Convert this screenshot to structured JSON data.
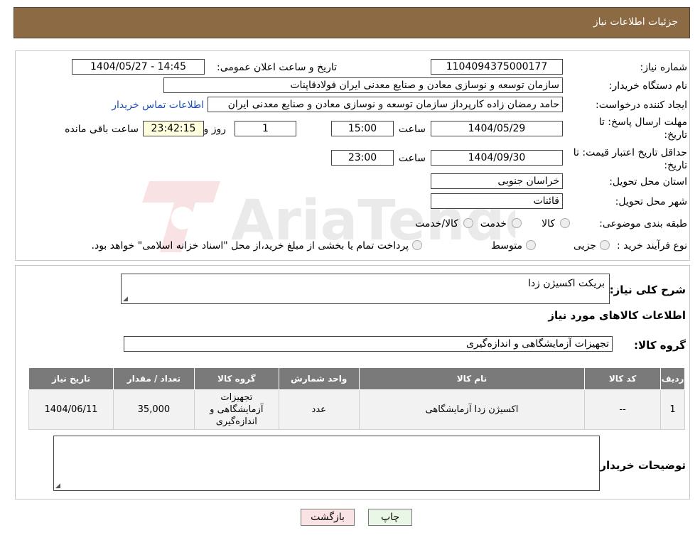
{
  "header": {
    "title": "جزئیات اطلاعات نیاز"
  },
  "form": {
    "need_number_label": "شماره نیاز:",
    "need_number": "1104094375000177",
    "announce_label": "تاریخ و ساعت اعلان عمومی:",
    "announce_value": "1404/05/27 - 14:45",
    "buyer_org_label": "نام دستگاه خریدار:",
    "buyer_org": "سازمان توسعه و نوسازی معادن و صنایع معدنی ایران فولادقاپنات",
    "requester_label": "ایجاد کننده درخواست:",
    "requester": "حامد  رمضان زاده  کارپرداز  سازمان توسعه و نوسازی معادن و صنایع معدنی ایران",
    "contact_link": "اطلاعات تماس خریدار",
    "deadline_label_1": "مهلت ارسال پاسخ: تا",
    "deadline_label_2": "تاریخ:",
    "deadline_date": "1404/05/29",
    "time_label": "ساعت",
    "deadline_time": "15:00",
    "days_value": "1",
    "days_label": "روز و",
    "remaining_value": "23:42:15",
    "remaining_label": "ساعت باقی مانده",
    "validity_label_1": "حداقل تاریخ اعتبار قیمت: تا",
    "validity_label_2": "تاریخ:",
    "validity_date": "1404/09/30",
    "validity_time": "23:00",
    "province_label": "استان محل تحویل:",
    "province": "خراسان جنوبی",
    "city_label": "شهر محل تحویل:",
    "city": "قائنات",
    "category_label": "طبقه بندی موضوعی:",
    "category_options": [
      "کالا",
      "خدمت",
      "کالا/خدمت"
    ],
    "process_label": "نوع فرآیند خرید :",
    "process_options": [
      "جزیی",
      "متوسط"
    ],
    "process_note": "پرداخت تمام یا بخشی از مبلغ خرید،از محل \"اسناد خزانه اسلامی\" خواهد بود."
  },
  "watermark": {
    "text": "AriaTender.neT"
  },
  "details": {
    "summary_label": "شرح کلی نیاز:",
    "summary": "بریکت اکسیژن زدا",
    "goods_title": "اطلاعات کالاهای مورد نیاز",
    "group_label": "گروه کالا:",
    "group_value": "تجهیزات آزمایشگاهی و اندازه‌گیری",
    "table": {
      "headers": [
        "ردیف",
        "کد کالا",
        "نام کالا",
        "واحد شمارش",
        "گروه کالا",
        "تعداد / مقدار",
        "تاریخ نیاز"
      ],
      "rows": [
        [
          "1",
          "--",
          "اکسیژن زدا آزمایشگاهی",
          "عدد",
          "تجهیزات آزمایشگاهی و اندازه‌گیری",
          "35,000",
          "1404/06/11"
        ]
      ]
    },
    "buyer_notes_label": "توضیحات خریدار:",
    "buyer_notes": ""
  },
  "buttons": {
    "print": "چاپ",
    "back": "بازگشت"
  },
  "colors": {
    "header_bg": "#8b6a44",
    "table_header_bg": "#7a7a7a",
    "print_bg": "#e9f7e6",
    "back_bg": "#fbe3e3"
  }
}
